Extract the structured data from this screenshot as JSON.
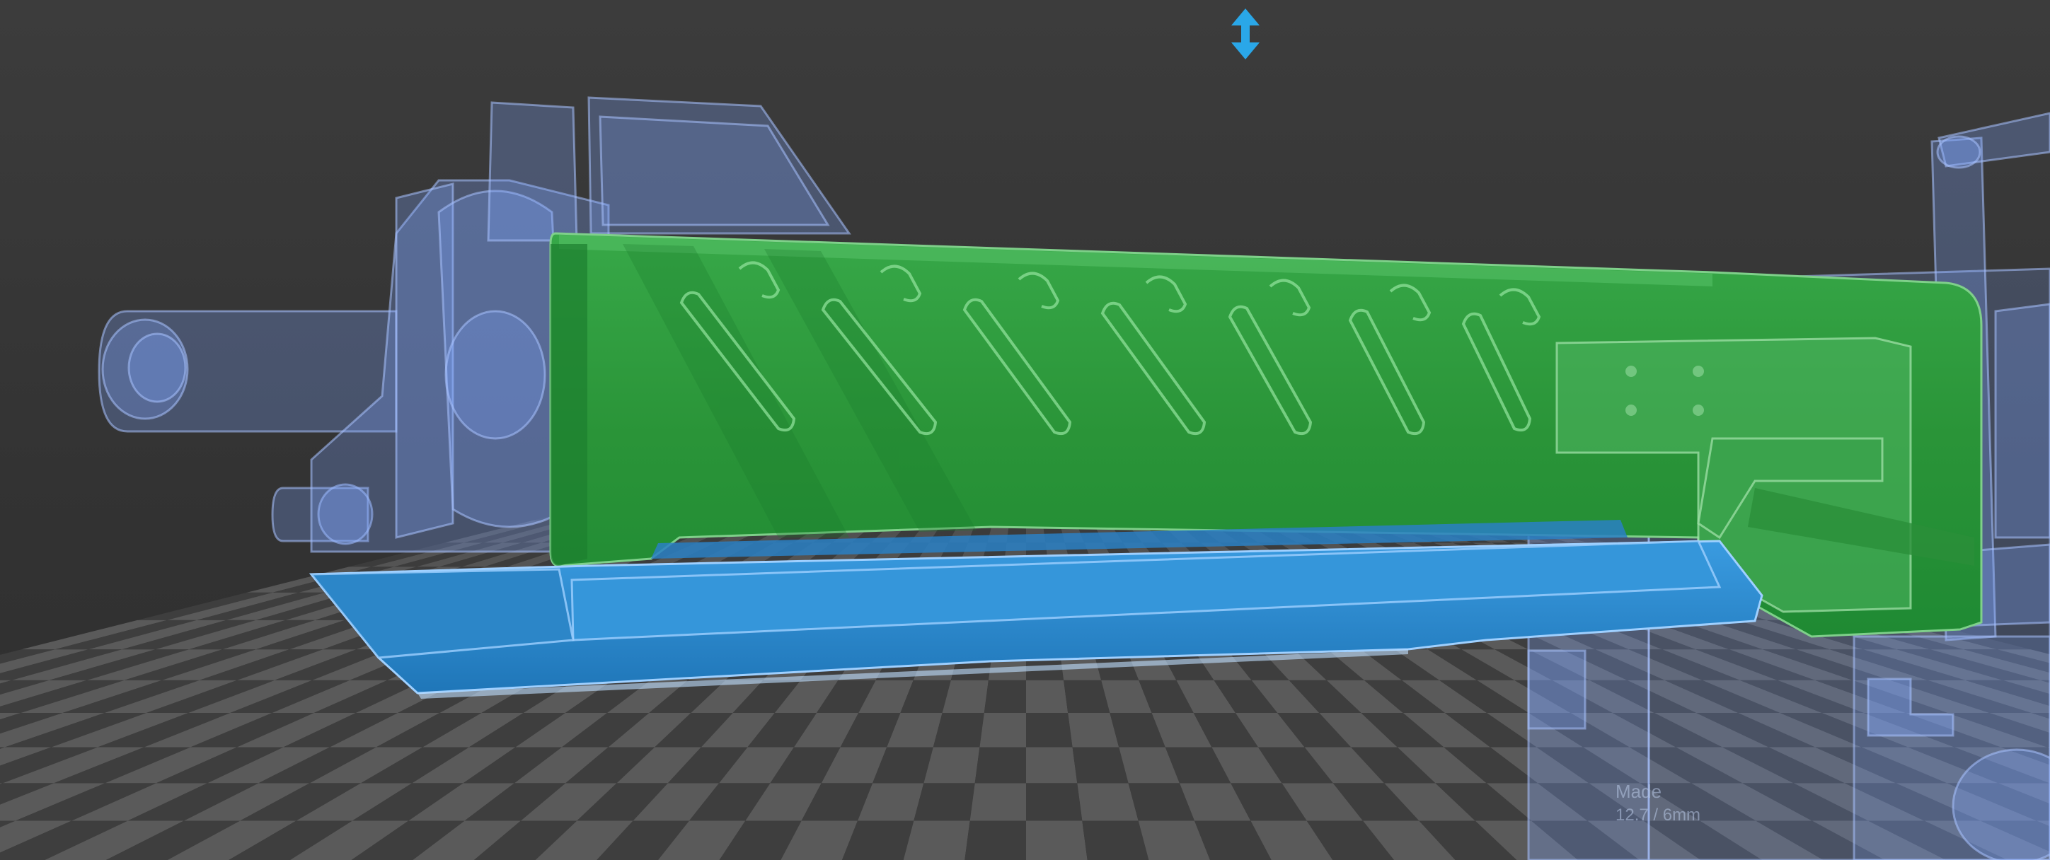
{
  "viewport": {
    "background": "#3a3a3a",
    "floor_dark": "#3e3e3e",
    "floor_light": "#5a5a5a"
  },
  "gizmo": {
    "icon": "vertical-move-arrow-icon",
    "color": "#2aa7e8"
  },
  "parts": {
    "selected_color": "#2e9a3c",
    "highlight_color": "#2e8fd0",
    "ghost_color": "#7ea6ff"
  },
  "engraving": {
    "line1": "Made",
    "line2": "12.7 / 6mm"
  }
}
